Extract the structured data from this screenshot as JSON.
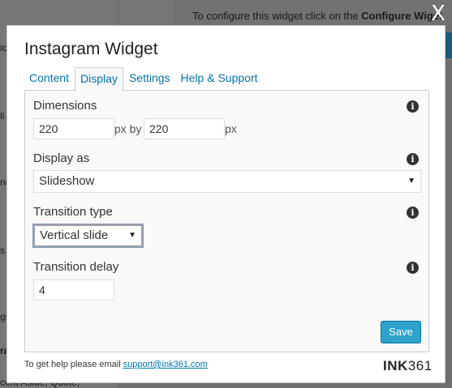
{
  "background": {
    "configure_text_prefix": "To configure this widget click on the ",
    "configure_text_bold": "Configure Wiget",
    "side_fragment_1": "ic",
    "side_fragment_2": "li",
    "side_fragment_3": "ne",
    "side_fragment_4": "s f",
    "side_fragment_5": "gs",
    "side_fragment_6": "ra",
    "bottom_fragment": "cent Aside, Quote,"
  },
  "window": {
    "close_label": "X"
  },
  "modal": {
    "title": "Instagram Widget",
    "tabs": [
      {
        "label": "Content"
      },
      {
        "label": "Display"
      },
      {
        "label": "Settings"
      },
      {
        "label": "Help & Support"
      }
    ],
    "active_tab": "Display",
    "fields": {
      "dimensions_label": "Dimensions",
      "width_value": "220",
      "px_by": "px by",
      "height_value": "220",
      "px": "px",
      "display_as_label": "Display as",
      "display_as_value": "Slideshow",
      "transition_type_label": "Transition type",
      "transition_type_value": "Vertical slide",
      "transition_delay_label": "Transition delay",
      "transition_delay_value": "4"
    },
    "info_glyph": "i",
    "caret_glyph": "▼",
    "save_label": "Save",
    "footer": {
      "help_text": "To get help please email ",
      "email": "support@ink361.com",
      "brand_bold": "INK",
      "brand_light": "361"
    }
  },
  "colors": {
    "accent": "#0073aa",
    "button": "#2ea2cc"
  }
}
